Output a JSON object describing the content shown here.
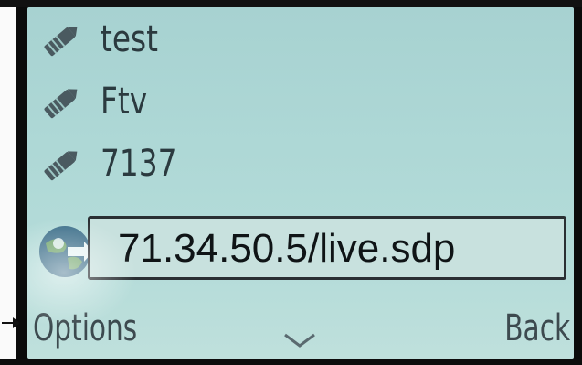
{
  "bookmarks": {
    "items": [
      {
        "label": "test",
        "icon": "bookmark-icon"
      },
      {
        "label": "Ftv",
        "icon": "bookmark-icon"
      },
      {
        "label": "7137",
        "icon": "bookmark-icon"
      }
    ]
  },
  "address_bar": {
    "value": "71.34.50.5/live.sdp",
    "icon": "globe-arrow-icon"
  },
  "softkeys": {
    "left_label": "Options",
    "right_label": "Back",
    "center_icon": "chevron-down-icon"
  },
  "colors": {
    "screen_background": "#aed8d6",
    "text": "#2b3a3f",
    "address_text": "#0f1416"
  }
}
